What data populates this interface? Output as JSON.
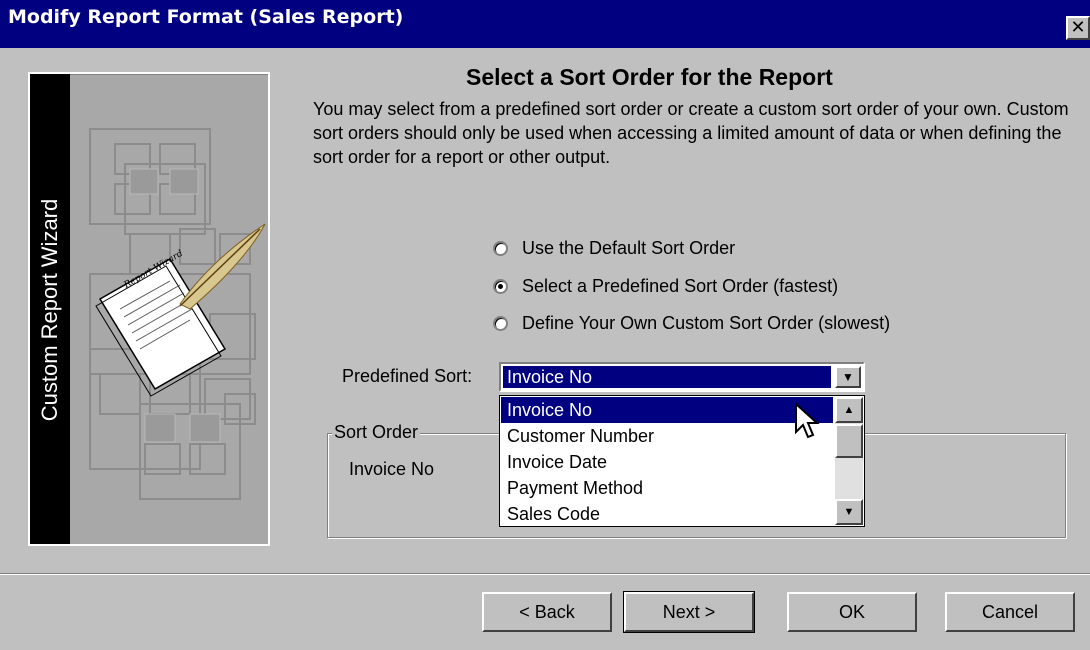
{
  "window": {
    "title": "Modify Report Format (Sales Report)",
    "close_glyph": "✕"
  },
  "wizard": {
    "strip_label": "Custom Report Wizard",
    "paper_text": "Report Wizard"
  },
  "page": {
    "heading": "Select a Sort Order for the Report",
    "description": "You may select from a predefined sort order or create a custom sort order of your own. Custom sort orders should only be used when accessing a limited amount of data or when defining the sort order for a report or other output."
  },
  "sort_mode": {
    "options": [
      {
        "label": "Use the Default Sort Order",
        "checked": false
      },
      {
        "label": "Select a Predefined Sort Order (fastest)",
        "checked": true
      },
      {
        "label": "Define Your Own Custom Sort Order (slowest)",
        "checked": false
      }
    ]
  },
  "predefined": {
    "label": "Predefined Sort:",
    "value": "Invoice No",
    "dropdown_glyph": "▼",
    "list": [
      "Invoice No",
      "Customer Number",
      "Invoice Date",
      "Payment Method",
      "Sales Code"
    ],
    "list_selected": "Invoice No",
    "scroll_up": "▲",
    "scroll_down": "▼"
  },
  "sort_order": {
    "group_label": "Sort Order",
    "value": "Invoice No"
  },
  "buttons": {
    "back": "< Back",
    "next": "Next >",
    "ok": "OK",
    "cancel": "Cancel"
  },
  "colors": {
    "title_bar": "#000080",
    "face": "#c0c0c0",
    "selection": "#000080"
  }
}
